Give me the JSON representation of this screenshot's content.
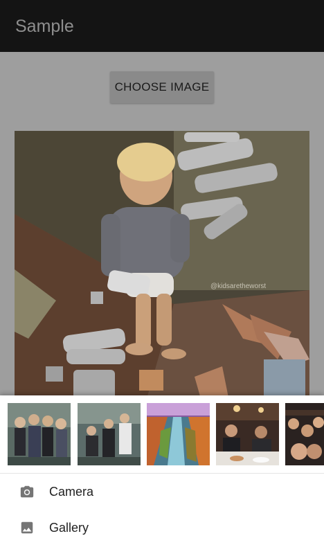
{
  "app_bar": {
    "title": "Sample"
  },
  "main": {
    "choose_button_label": "CHOOSE IMAGE",
    "photo_watermark": "@kidsaretheworst"
  },
  "picker": {
    "thumbnails": [
      {
        "subject": "group-of-friends-photo"
      },
      {
        "subject": "group-posing-photo"
      },
      {
        "subject": "aerial-river-landscape-photo"
      },
      {
        "subject": "restaurant-dinner-photo"
      },
      {
        "subject": "friends-selfie-photo"
      }
    ],
    "options": [
      {
        "label": "Camera",
        "icon": "camera-icon"
      },
      {
        "label": "Gallery",
        "icon": "image-icon"
      }
    ]
  }
}
